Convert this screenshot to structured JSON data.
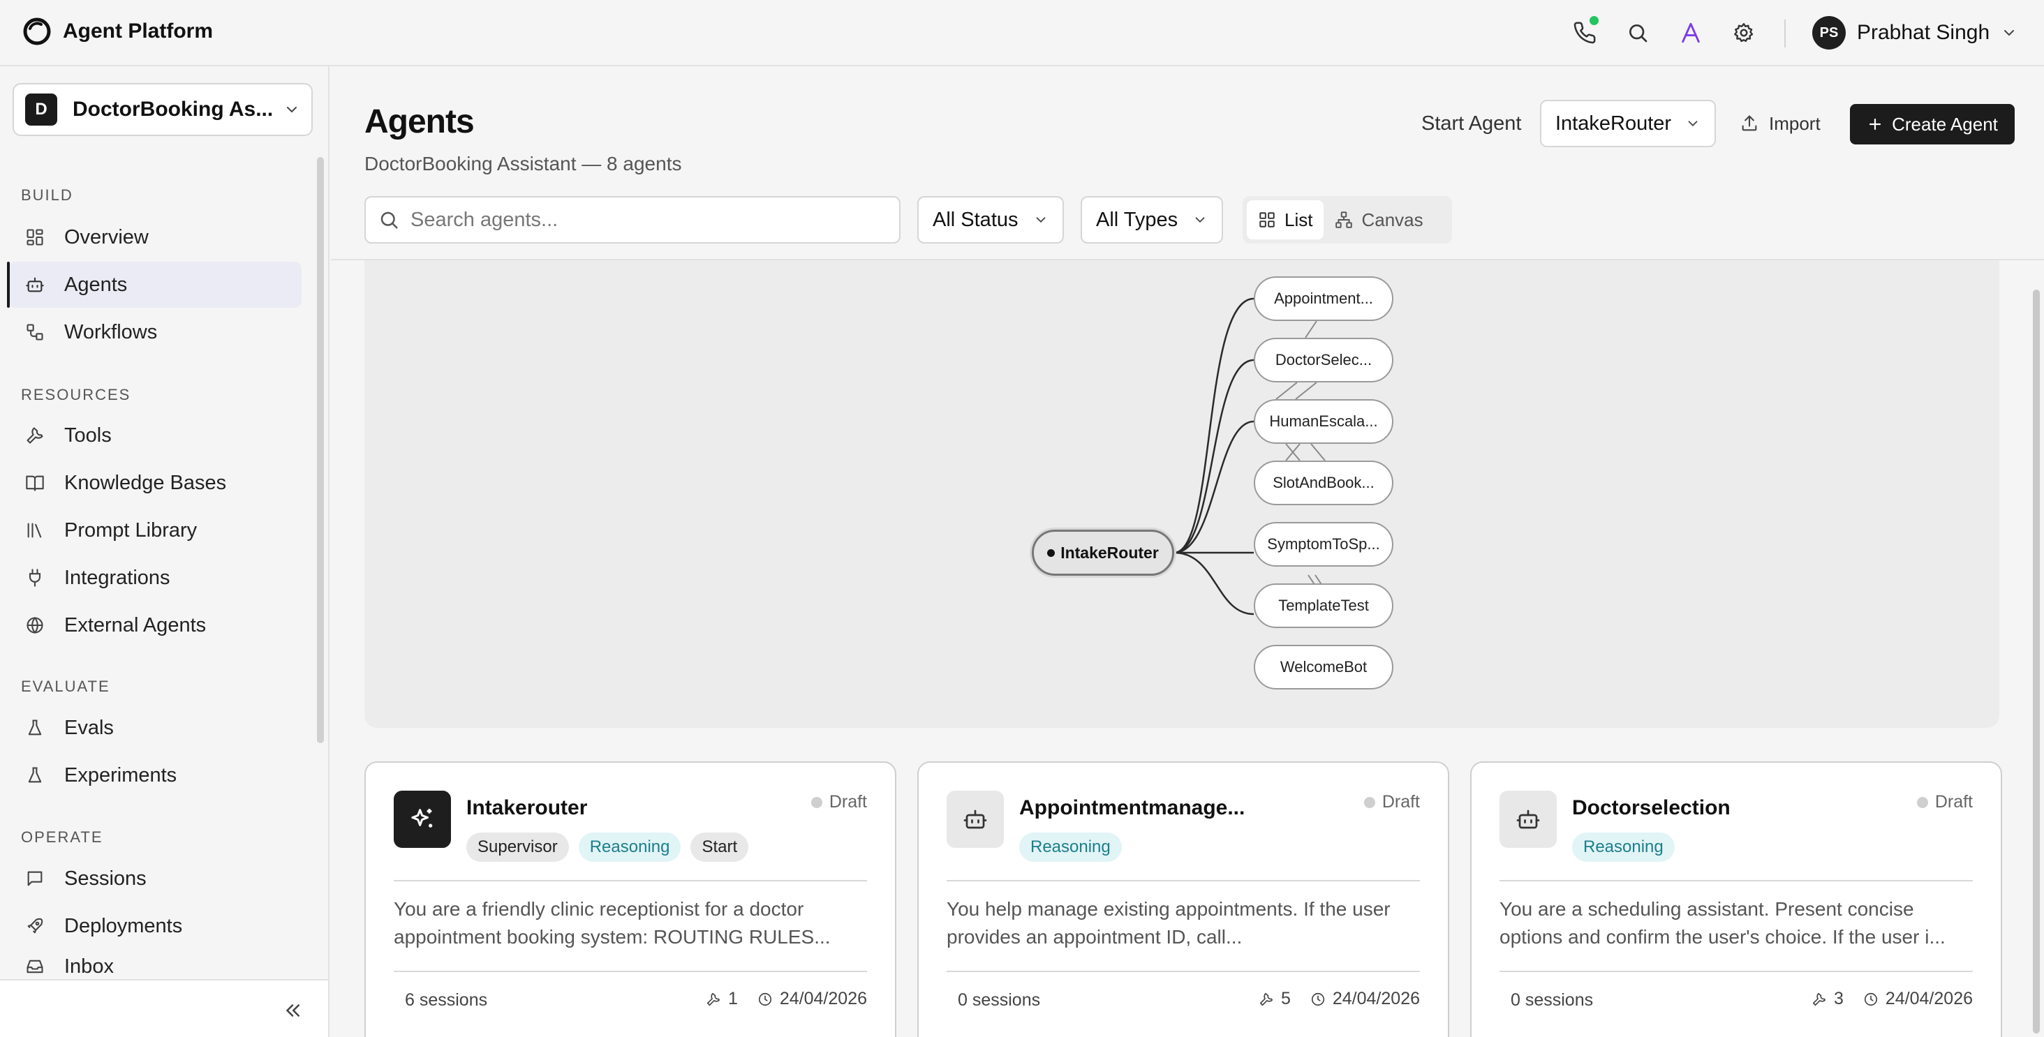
{
  "app": {
    "title": "Agent Platform"
  },
  "user": {
    "initials": "PS",
    "name": "Prabhat Singh"
  },
  "workspace": {
    "initial": "D",
    "name": "DoctorBooking As..."
  },
  "sidebar": {
    "sections": [
      {
        "title": "BUILD",
        "items": [
          {
            "label": "Overview",
            "icon": "overview-grid-icon"
          },
          {
            "label": "Agents",
            "icon": "robot-icon",
            "active": true
          },
          {
            "label": "Workflows",
            "icon": "workflow-icon"
          }
        ]
      },
      {
        "title": "RESOURCES",
        "items": [
          {
            "label": "Tools",
            "icon": "wrench-icon"
          },
          {
            "label": "Knowledge Bases",
            "icon": "book-icon"
          },
          {
            "label": "Prompt Library",
            "icon": "library-icon"
          },
          {
            "label": "Integrations",
            "icon": "plug-icon"
          },
          {
            "label": "External Agents",
            "icon": "globe-icon"
          }
        ]
      },
      {
        "title": "EVALUATE",
        "items": [
          {
            "label": "Evals",
            "icon": "flask-icon"
          },
          {
            "label": "Experiments",
            "icon": "flask-icon"
          }
        ]
      },
      {
        "title": "OPERATE",
        "items": [
          {
            "label": "Sessions",
            "icon": "chat-icon"
          },
          {
            "label": "Deployments",
            "icon": "rocket-icon"
          },
          {
            "label": "Inbox",
            "icon": "inbox-icon"
          }
        ]
      }
    ],
    "collapse_icon": "double-chevron-left-icon"
  },
  "page": {
    "title": "Agents",
    "subtitle": "DoctorBooking Assistant — 8 agents",
    "start_agent_label": "Start Agent",
    "start_agent_value": "IntakeRouter",
    "import_label": "Import",
    "create_label": "Create Agent"
  },
  "filters": {
    "search_placeholder": "Search agents...",
    "status": "All Status",
    "types": "All Types",
    "view_list": "List",
    "view_canvas": "Canvas"
  },
  "graph": {
    "root": "IntakeRouter",
    "nodes": [
      "Appointment...",
      "DoctorSelec...",
      "HumanEscala...",
      "SlotAndBook...",
      "SymptomToSp...",
      "TemplateTest",
      "WelcomeBot"
    ]
  },
  "cards": [
    {
      "name": "Intakerouter",
      "status": "Draft",
      "tags": [
        {
          "label": "Supervisor",
          "style": "gray"
        },
        {
          "label": "Reasoning",
          "style": "teal"
        },
        {
          "label": "Start",
          "style": "gray"
        }
      ],
      "description": "You are a friendly clinic receptionist for a doctor appointment booking system: ROUTING RULES...",
      "sessions": "6 sessions",
      "tools": "1",
      "date": "24/04/2026",
      "icon": "sparkles-icon"
    },
    {
      "name": "Appointmentmanage...",
      "status": "Draft",
      "tags": [
        {
          "label": "Reasoning",
          "style": "teal"
        }
      ],
      "description": "You help manage existing appointments. If the user provides an appointment ID, call...",
      "sessions": "0 sessions",
      "tools": "5",
      "date": "24/04/2026",
      "icon": "robot-icon"
    },
    {
      "name": "Doctorselection",
      "status": "Draft",
      "tags": [
        {
          "label": "Reasoning",
          "style": "teal"
        }
      ],
      "description": "You are a scheduling assistant. Present concise options and confirm the user's choice. If the user i...",
      "sessions": "0 sessions",
      "tools": "3",
      "date": "24/04/2026",
      "icon": "robot-icon"
    }
  ],
  "colors": {
    "accent_purple": "#7c3aed",
    "online_green": "#22c55e",
    "reasoning_teal": "#1d7f8c"
  }
}
